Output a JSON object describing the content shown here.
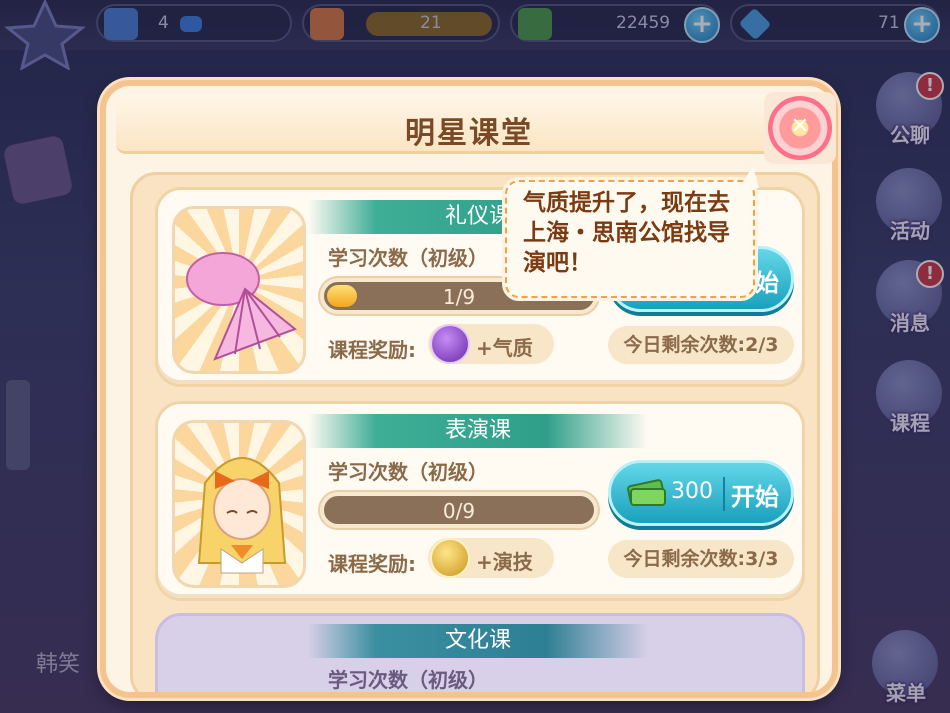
{
  "top_bar": {
    "level": "4",
    "energy": "21",
    "money": "22459",
    "diamonds": "71",
    "money_icon": "cash-icon",
    "diamond_icon": "diamond-icon"
  },
  "side_menu": [
    {
      "label": "公聊",
      "badge": "!"
    },
    {
      "label": "活动",
      "badge": ""
    },
    {
      "label": "消息",
      "badge": "!"
    },
    {
      "label": "课程",
      "badge": ""
    }
  ],
  "bottom_menu_label": "菜单",
  "bottom_left_name": "韩笑",
  "dialog": {
    "title": "明星课堂",
    "close_icon": "close-icon",
    "courses": [
      {
        "name": "礼仪课",
        "study_label": "学习次数（初级）",
        "progress_text": "1/9",
        "progress": 0.11,
        "reward_label": "课程奖励:",
        "reward_text": "+气质",
        "remaining": "今日剩余次数:2/3",
        "cost": "",
        "start_label": "开始"
      },
      {
        "name": "表演课",
        "study_label": "学习次数（初级）",
        "progress_text": "0/9",
        "progress": 0,
        "reward_label": "课程奖励:",
        "reward_text": "+演技",
        "remaining": "今日剩余次数:3/3",
        "cost": "300",
        "start_label": "开始"
      },
      {
        "name": "文化课",
        "study_label": "学习次数（初级）"
      }
    ]
  },
  "tooltip": {
    "message": "气质提升了，现在去上海・思南公馆找导演吧！"
  },
  "colors": {
    "panel_bg": "#fdf4e6",
    "band_teal": "#3fae97",
    "button_cyan": "#1aa0bd",
    "bubble_border": "#f0a14a"
  }
}
